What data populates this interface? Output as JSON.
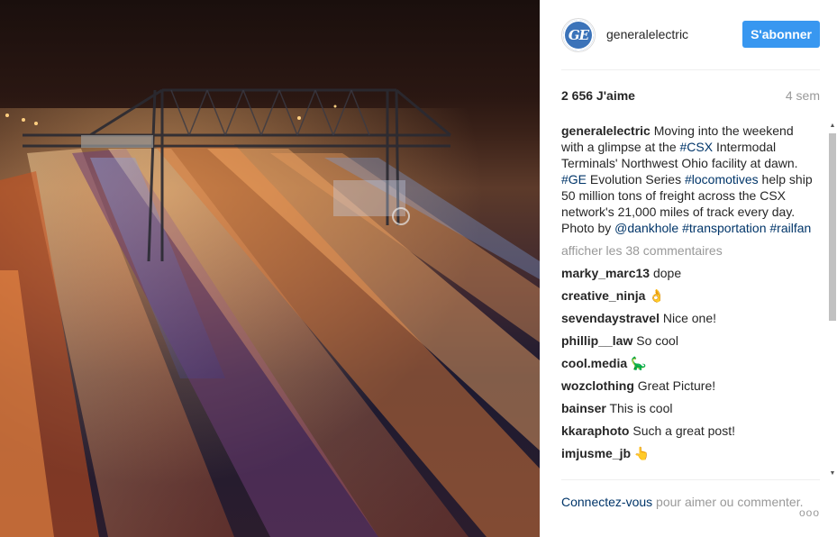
{
  "photo": {
    "alt": ""
  },
  "header": {
    "avatar_text": "GE",
    "username": "generalelectric",
    "follow_label": "S'abonner"
  },
  "stats": {
    "likes": "2 656 J'aime",
    "age": "4 sem"
  },
  "caption": {
    "user": "generalelectric",
    "t1": " Moving into the weekend with a glimpse at the ",
    "tag_csx": "#CSX",
    "t2": " Intermodal Terminals' Northwest Ohio facility at dawn. ",
    "tag_ge": "#GE",
    "t3": " Evolution Series ",
    "tag_loco": "#locomotives",
    "t4": " help ship 50 million tons of freight across the CSX network's 21,000 miles of track every day. Photo by ",
    "mention": "@dankhole",
    "t5": " ",
    "tag_transport": "#transportation",
    "t6": " ",
    "tag_railfan": "#railfan"
  },
  "view_all": "afficher les 38 commentaires",
  "comments": [
    {
      "user": "marky_marc13",
      "text": " dope"
    },
    {
      "user": "creative_ninja",
      "text": " 👌"
    },
    {
      "user": "sevendaystravel",
      "text": " Nice one!"
    },
    {
      "user": "phillip__law",
      "text": " So cool"
    },
    {
      "user": "cool.media",
      "text": " 🦕"
    },
    {
      "user": "wozclothing",
      "text": " Great Picture!"
    },
    {
      "user": "bainser",
      "text": " This is cool"
    },
    {
      "user": "kkaraphoto",
      "text": " Such a great post!"
    },
    {
      "user": "imjusme_jb",
      "text": " 👆"
    }
  ],
  "footer": {
    "login_link": "Connectez-vous",
    "rest": " pour aimer ou commenter.",
    "more": "ooo"
  },
  "colors": {
    "follow_button": "#3897f0",
    "link": "#003569",
    "muted": "#999999",
    "ge_blue": "#3b73b9"
  },
  "icons": {
    "more": "more-options-icon",
    "scroll_up": "scroll-up-icon",
    "scroll_down": "scroll-down-icon"
  }
}
